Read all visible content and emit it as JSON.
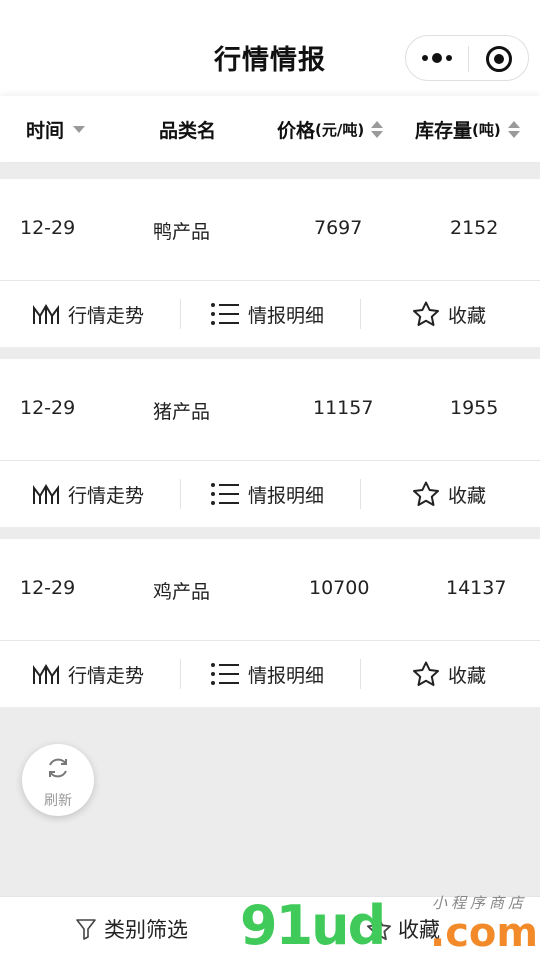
{
  "nav": {
    "title": "行情情报"
  },
  "table_header": {
    "time": "时间",
    "category": "品类名",
    "price": "价格",
    "price_unit": "(元/吨)",
    "stock": "库存量",
    "stock_unit": "(吨)"
  },
  "rows": [
    {
      "date": "12-29",
      "name": "鸭产品",
      "price": "7697",
      "stock": "2152"
    },
    {
      "date": "12-29",
      "name": "猪产品",
      "price": "11157",
      "stock": "1955"
    },
    {
      "date": "12-29",
      "name": "鸡产品",
      "price": "10700",
      "stock": "14137"
    }
  ],
  "actions": {
    "trend": "行情走势",
    "detail": "情报明细",
    "favorite": "收藏"
  },
  "refresh": {
    "label": "刷新"
  },
  "bottom": {
    "filter": "类别筛选",
    "favorite": "收藏"
  },
  "watermark": {
    "main": "91ud",
    "suffix": ".com",
    "sub": "小程序商店"
  },
  "colors": {
    "accent_green": "#3fca5a",
    "accent_orange": "#f28a2a",
    "background": "#ececec"
  }
}
